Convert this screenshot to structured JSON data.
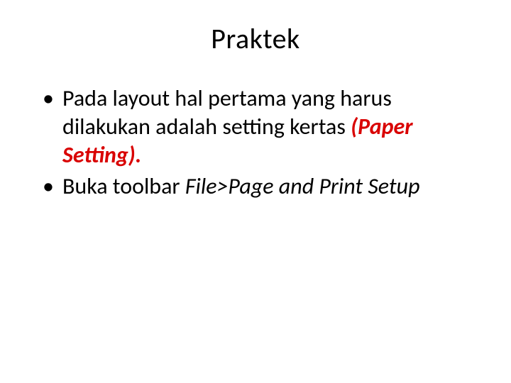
{
  "title": "Praktek",
  "bullets": [
    {
      "prefix": "Pada layout hal pertama yang harus dilakukan adalah setting kertas ",
      "emphasis": "(Paper Setting).",
      "suffix": ""
    },
    {
      "prefix": "Buka toolbar ",
      "emphasis": "File>Page and Print Setup",
      "suffix": ""
    }
  ]
}
